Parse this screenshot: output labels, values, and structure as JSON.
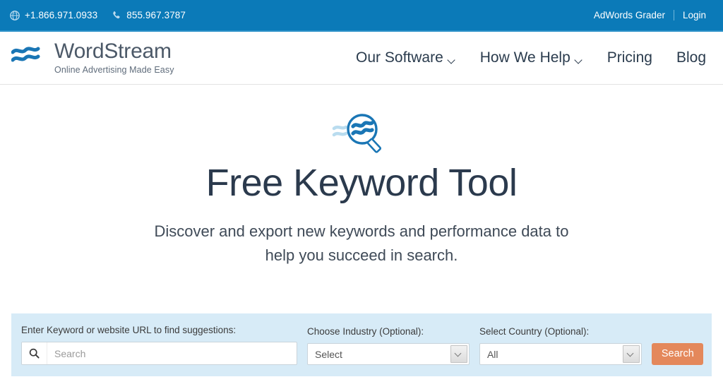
{
  "topbar": {
    "phones": [
      {
        "icon": "globe-icon",
        "number": "+1.866.971.0933"
      },
      {
        "icon": "phone-icon",
        "number": "855.967.3787"
      }
    ],
    "adwords_grader_label": "AdWords Grader",
    "login_label": "Login",
    "background_color": "#0b7ab8"
  },
  "header": {
    "brand_name": "WordStream",
    "brand_tagline": "Online Advertising Made Easy",
    "logo_icon": "wordstream-waves-logo",
    "nav": [
      {
        "label": "Our Software",
        "has_dropdown": true
      },
      {
        "label": "How We Help",
        "has_dropdown": true
      },
      {
        "label": "Pricing",
        "has_dropdown": false
      },
      {
        "label": "Blog",
        "has_dropdown": false
      }
    ]
  },
  "hero": {
    "icon": "magnifier-waves-icon",
    "title": "Free Keyword Tool",
    "subtitle_line1": "Discover and export new keywords and performance data to",
    "subtitle_line2": "help you succeed in search."
  },
  "search_panel": {
    "background_color": "#d7ebf7",
    "keyword": {
      "label": "Enter Keyword or website URL to find suggestions:",
      "icon": "search-icon",
      "value": "",
      "placeholder": "Search"
    },
    "industry": {
      "label": "Choose Industry (Optional):",
      "selected": "Select"
    },
    "country": {
      "label": "Select Country (Optional):",
      "selected": "All"
    },
    "search_button_label": "Search",
    "search_button_color": "#e4885b"
  }
}
